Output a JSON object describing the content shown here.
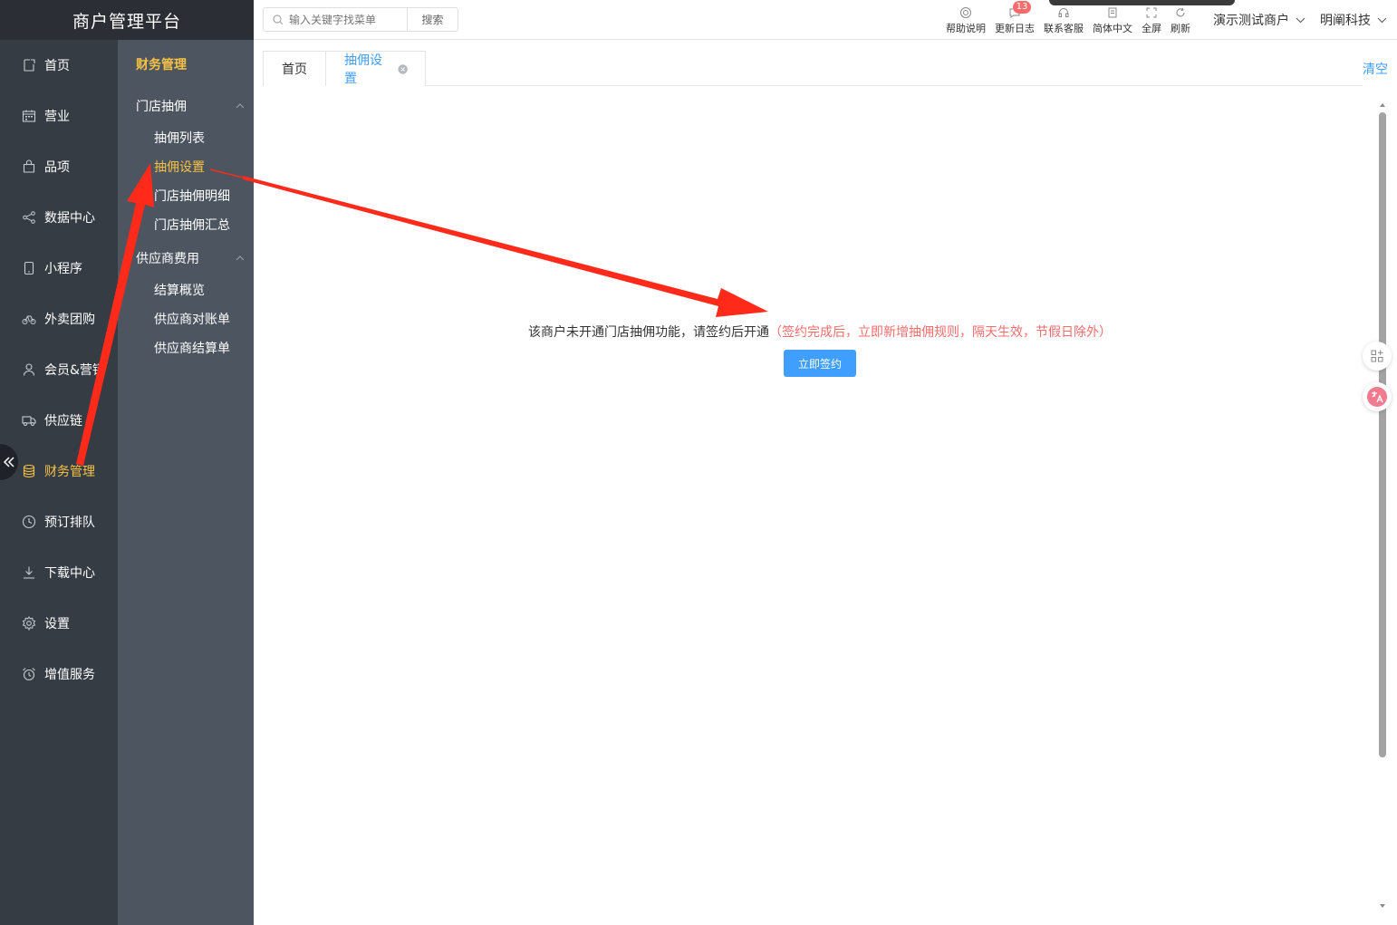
{
  "app": {
    "title": "商户管理平台"
  },
  "search": {
    "placeholder": "输入关键字找菜单",
    "button_label": "搜索"
  },
  "toolbar": {
    "help": "帮助说明",
    "changelog": "更新日志",
    "changelog_badge": "13",
    "support": "联系客服",
    "language": "简体中文",
    "fullscreen": "全屏",
    "refresh": "刷新"
  },
  "account": {
    "merchant": "演示测试商户",
    "company": "明阐科技"
  },
  "rail": {
    "items": [
      {
        "label": "首页",
        "icon": "home-icon"
      },
      {
        "label": "营业",
        "icon": "calendar-icon"
      },
      {
        "label": "品项",
        "icon": "bag-icon"
      },
      {
        "label": "数据中心",
        "icon": "share-icon"
      },
      {
        "label": "小程序",
        "icon": "phone-icon"
      },
      {
        "label": "外卖团购",
        "icon": "bike-icon"
      },
      {
        "label": "会员&营销",
        "icon": "user-icon"
      },
      {
        "label": "供应链",
        "icon": "truck-icon"
      },
      {
        "label": "财务管理",
        "icon": "database-icon",
        "active": true
      },
      {
        "label": "预订排队",
        "icon": "clock-icon"
      },
      {
        "label": "下载中心",
        "icon": "download-icon"
      },
      {
        "label": "设置",
        "icon": "gear-icon"
      },
      {
        "label": "增值服务",
        "icon": "alarm-icon"
      }
    ]
  },
  "submenu": {
    "title": "财务管理",
    "groups": [
      {
        "label": "门店抽佣",
        "items": [
          "抽佣列表",
          "抽佣设置",
          "门店抽佣明细",
          "门店抽佣汇总"
        ]
      },
      {
        "label": "供应商费用",
        "items": [
          "结算概览",
          "供应商对账单",
          "供应商结算单"
        ]
      }
    ],
    "active_item": "抽佣设置"
  },
  "tabs": [
    {
      "label": "首页"
    },
    {
      "label": "抽佣设置",
      "active": true
    }
  ],
  "clear_label": "清空",
  "content": {
    "notice": "该商户未开通门店抽佣功能，请签约后开通",
    "notice_hint": "（签约完成后，立即新增抽佣规则，隔天生效，节假日除外）",
    "sign_button": "立即签约"
  },
  "colors": {
    "brand_bg": "#2b2f35",
    "rail_bg": "#353c44",
    "submenu_bg": "#4d5560",
    "accent_yellow": "#f7c244",
    "primary_blue": "#409eff",
    "danger_red": "#f56c6c",
    "annotation_red": "#ff2a1a"
  }
}
